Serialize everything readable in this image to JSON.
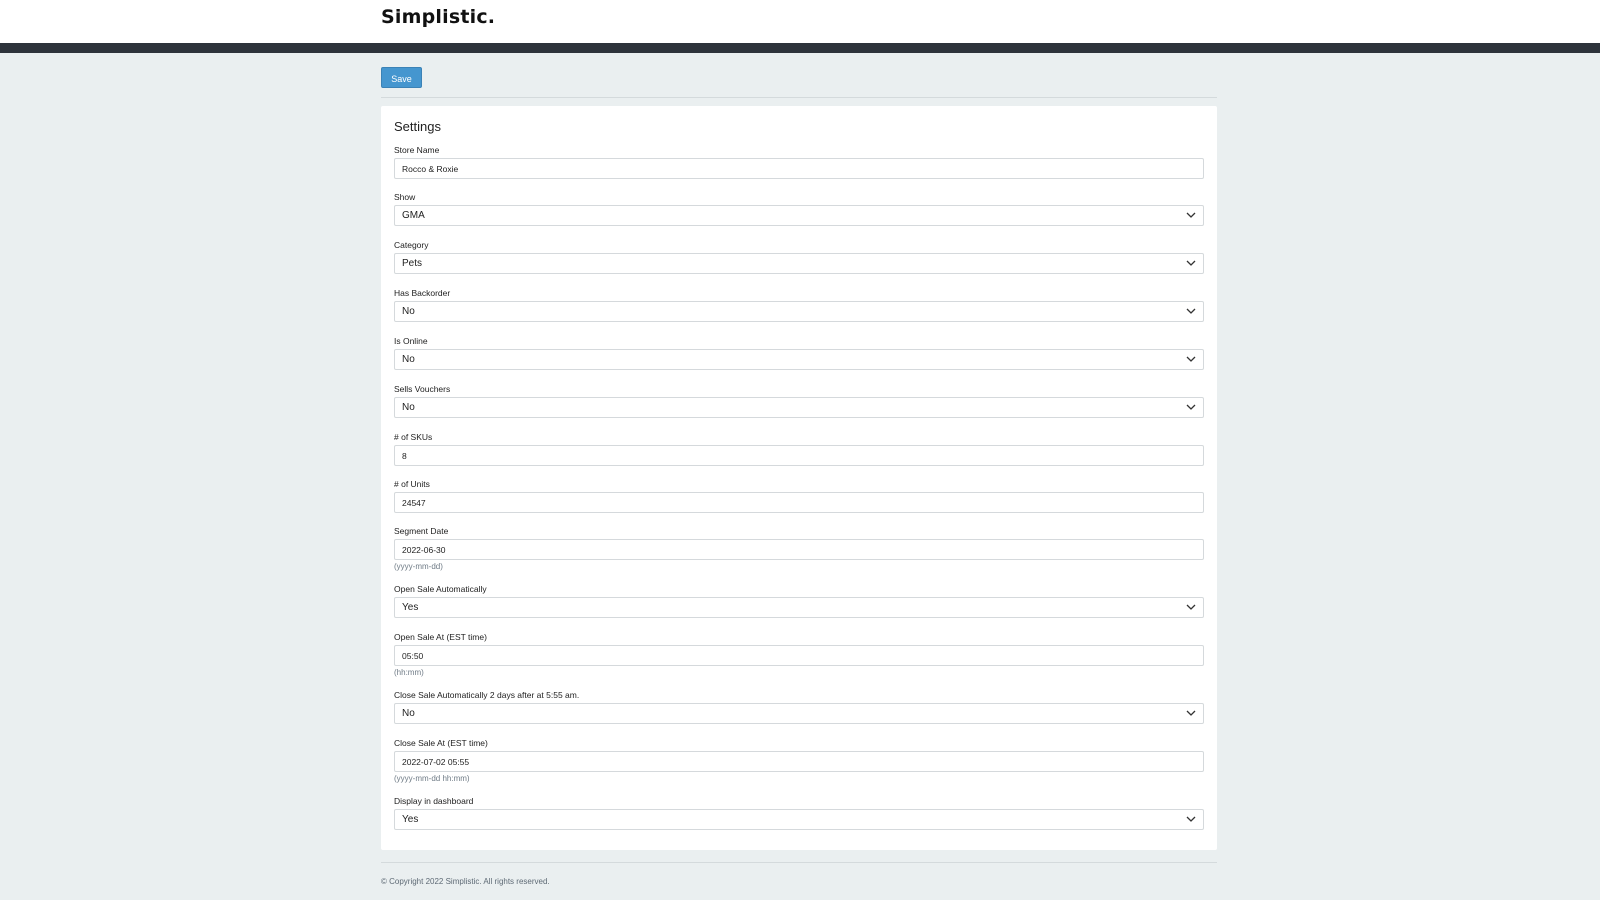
{
  "header": {
    "logo": "Simplistic."
  },
  "toolbar": {
    "save_label": "Save"
  },
  "settings": {
    "title": "Settings",
    "store_name": {
      "label": "Store Name",
      "value": "Rocco & Roxie"
    },
    "show": {
      "label": "Show",
      "value": "GMA"
    },
    "category": {
      "label": "Category",
      "value": "Pets"
    },
    "has_backorder": {
      "label": "Has Backorder",
      "value": "No"
    },
    "is_online": {
      "label": "Is Online",
      "value": "No"
    },
    "sells_vouchers": {
      "label": "Sells Vouchers",
      "value": "No"
    },
    "num_skus": {
      "label": "# of SKUs",
      "value": "8"
    },
    "num_units": {
      "label": "# of Units",
      "value": "24547"
    },
    "segment_date": {
      "label": "Segment Date",
      "value": "2022-06-30",
      "hint": "(yyyy-mm-dd)"
    },
    "open_sale_auto": {
      "label": "Open Sale Automatically",
      "value": "Yes"
    },
    "open_sale_at": {
      "label": "Open Sale At (EST time)",
      "value": "05:50",
      "hint": "(hh:mm)"
    },
    "close_sale_auto": {
      "label": "Close Sale Automatically 2 days after at 5:55 am.",
      "value": "No"
    },
    "close_sale_at": {
      "label": "Close Sale At (EST time)",
      "value": "2022-07-02 05:55",
      "hint": "(yyyy-mm-dd hh:mm)"
    },
    "display_dashboard": {
      "label": "Display in dashboard",
      "value": "Yes"
    }
  },
  "footer": {
    "copyright": "© Copyright 2022 Simplistic. All rights reserved."
  },
  "colors": {
    "primary_button": "#4596cf",
    "dark_bar": "#2e333b",
    "page_background": "#eaeff0"
  },
  "icons": {
    "select_indicator": "chevron-down-icon"
  }
}
